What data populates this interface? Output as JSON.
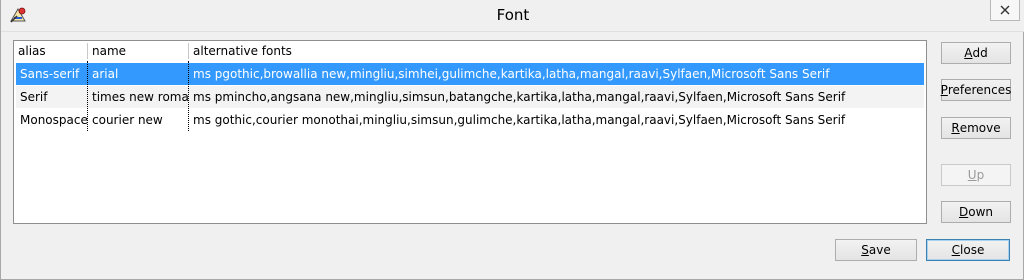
{
  "window": {
    "title": "Font",
    "icon": "app-font-icon",
    "close_icon": "close-icon"
  },
  "table": {
    "columns": [
      "alias",
      "name",
      "alternative fonts"
    ],
    "rows": [
      {
        "alias": "Sans-serif",
        "name": "arial",
        "alternative": "ms pgothic,browallia new,mingliu,simhei,gulimche,kartika,latha,mangal,raavi,Sylfaen,Microsoft Sans Serif",
        "selected": true
      },
      {
        "alias": "Serif",
        "name": "times new roman",
        "alternative": "ms pmincho,angsana new,mingliu,simsun,batangche,kartika,latha,mangal,raavi,Sylfaen,Microsoft Sans Serif",
        "selected": false
      },
      {
        "alias": "Monospace",
        "name": "courier new",
        "alternative": "ms gothic,courier monothai,mingliu,simsun,gulimche,kartika,latha,mangal,raavi,Sylfaen,Microsoft Sans Serif",
        "selected": false
      }
    ]
  },
  "buttons": {
    "add": {
      "first": "A",
      "rest": "dd"
    },
    "preferences": {
      "first": "P",
      "rest": "references"
    },
    "remove": {
      "first": "R",
      "rest": "emove"
    },
    "up": {
      "first": "U",
      "rest": "p"
    },
    "down": {
      "first": "D",
      "rest": "own"
    },
    "save": {
      "first": "S",
      "rest": "ave"
    },
    "close": {
      "first": "C",
      "rest": "lose"
    }
  },
  "colors": {
    "selection": "#3399ff",
    "window_bg": "#f0f0f0"
  }
}
